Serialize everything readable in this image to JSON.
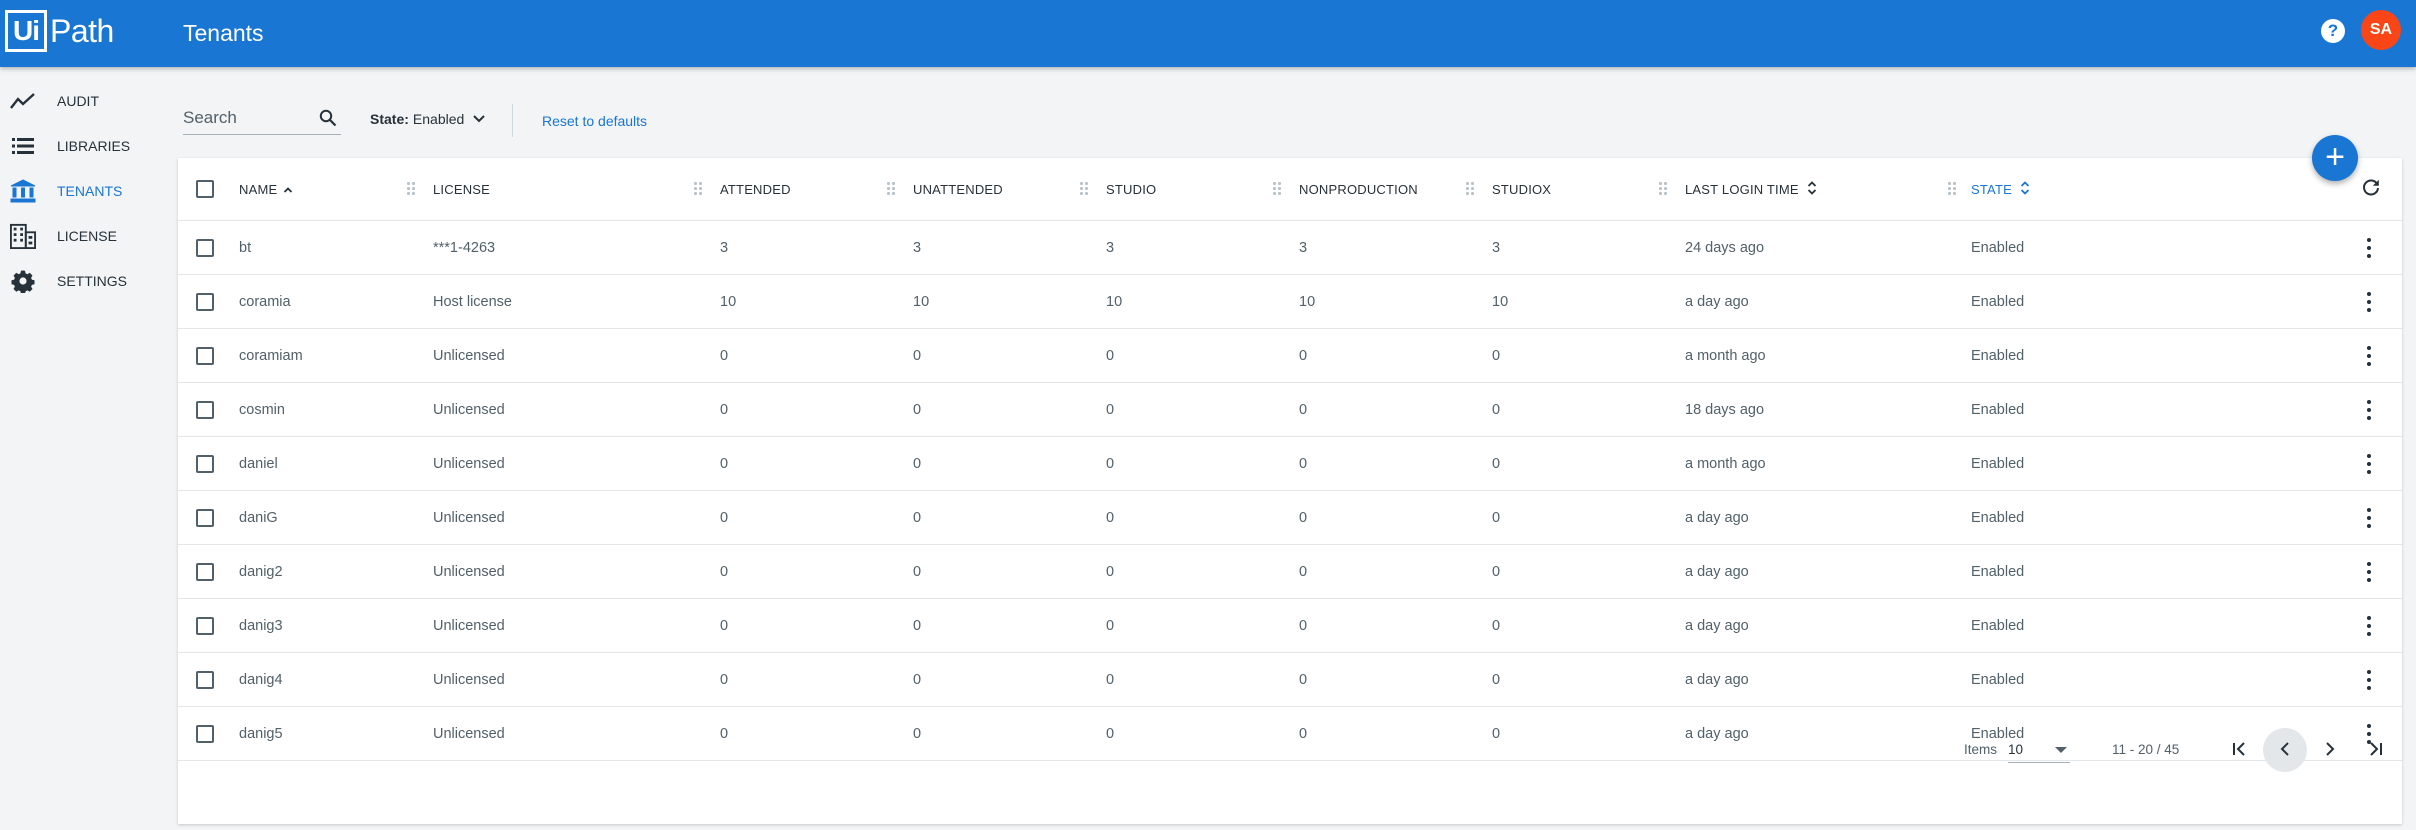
{
  "app": {
    "logo_ui": "Ui",
    "logo_path": "Path",
    "page_title": "Tenants",
    "help_label": "?",
    "avatar_initials": "SA",
    "brand_color": "#1976d2",
    "avatar_color": "#fa4616"
  },
  "sidebar": {
    "items": [
      {
        "label": "AUDIT",
        "icon": "trend-line-icon",
        "active": false
      },
      {
        "label": "LIBRARIES",
        "icon": "list-icon",
        "active": false
      },
      {
        "label": "TENANTS",
        "icon": "bank-icon",
        "active": true
      },
      {
        "label": "LICENSE",
        "icon": "building-icon",
        "active": false
      },
      {
        "label": "SETTINGS",
        "icon": "gear-icon",
        "active": false
      }
    ]
  },
  "toolbar": {
    "search_placeholder": "Search",
    "state_filter_label": "State:",
    "state_filter_value": "Enabled",
    "reset_label": "Reset to defaults",
    "add_label": "+"
  },
  "table": {
    "columns": [
      {
        "key": "name",
        "label": "NAME",
        "sort": "asc"
      },
      {
        "key": "license",
        "label": "LICENSE"
      },
      {
        "key": "attended",
        "label": "ATTENDED"
      },
      {
        "key": "unattended",
        "label": "UNATTENDED"
      },
      {
        "key": "studio",
        "label": "STUDIO"
      },
      {
        "key": "nonproduction",
        "label": "NONPRODUCTION"
      },
      {
        "key": "studiox",
        "label": "STUDIOX"
      },
      {
        "key": "last_login",
        "label": "LAST LOGIN TIME",
        "sort": "both"
      },
      {
        "key": "state",
        "label": "STATE",
        "sort": "both"
      }
    ],
    "rows": [
      [
        "bt",
        "***1-4263",
        "3",
        "3",
        "3",
        "3",
        "3",
        "24 days ago",
        "Enabled"
      ],
      [
        "coramia",
        "Host license",
        "10",
        "10",
        "10",
        "10",
        "10",
        "a day ago",
        "Enabled"
      ],
      [
        "coramiam",
        "Unlicensed",
        "0",
        "0",
        "0",
        "0",
        "0",
        "a month ago",
        "Enabled"
      ],
      [
        "cosmin",
        "Unlicensed",
        "0",
        "0",
        "0",
        "0",
        "0",
        "18 days ago",
        "Enabled"
      ],
      [
        "daniel",
        "Unlicensed",
        "0",
        "0",
        "0",
        "0",
        "0",
        "a month ago",
        "Enabled"
      ],
      [
        "daniG",
        "Unlicensed",
        "0",
        "0",
        "0",
        "0",
        "0",
        "a day ago",
        "Enabled"
      ],
      [
        "danig2",
        "Unlicensed",
        "0",
        "0",
        "0",
        "0",
        "0",
        "a day ago",
        "Enabled"
      ],
      [
        "danig3",
        "Unlicensed",
        "0",
        "0",
        "0",
        "0",
        "0",
        "a day ago",
        "Enabled"
      ],
      [
        "danig4",
        "Unlicensed",
        "0",
        "0",
        "0",
        "0",
        "0",
        "a day ago",
        "Enabled"
      ],
      [
        "danig5",
        "Unlicensed",
        "0",
        "0",
        "0",
        "0",
        "0",
        "a day ago",
        "Enabled"
      ]
    ]
  },
  "pagination": {
    "items_label": "Items",
    "page_size": "10",
    "range_text": "11 - 20 / 45"
  }
}
